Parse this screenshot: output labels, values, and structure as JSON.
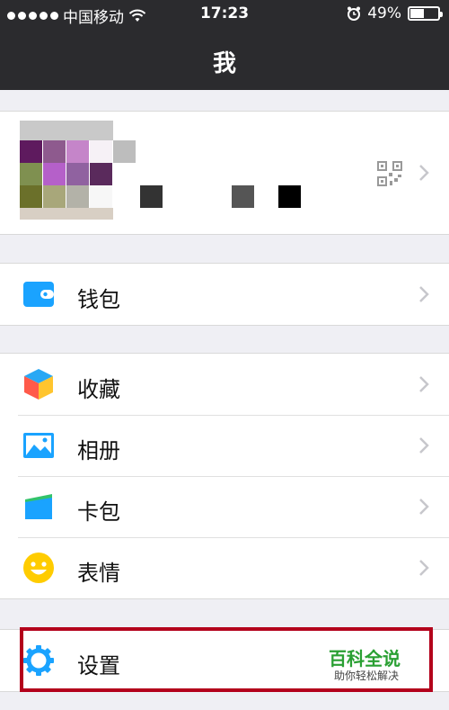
{
  "status_bar": {
    "carrier": "中国移动",
    "time": "17:23",
    "battery_percent": "49%",
    "battery_level": 0.49,
    "wifi_icon": "wifi-icon",
    "alarm_icon": "alarm-icon"
  },
  "navbar": {
    "title": "我"
  },
  "profile": {
    "avatar": "pixelated-avatar",
    "qr_icon": "qr-code-icon"
  },
  "menu": {
    "wallet": {
      "label": "钱包",
      "icon": "wallet-icon",
      "color": "#1aa3ff"
    },
    "favorites": {
      "label": "收藏",
      "icon": "cube-icon"
    },
    "album": {
      "label": "相册",
      "icon": "photo-icon",
      "color": "#1aa3ff"
    },
    "cards": {
      "label": "卡包",
      "icon": "card-icon"
    },
    "emoji": {
      "label": "表情",
      "icon": "smiley-icon",
      "color": "#ffcc00"
    },
    "settings": {
      "label": "设置",
      "icon": "gear-icon",
      "color": "#1aa3ff"
    }
  },
  "watermark": {
    "title": "百科全说",
    "subtitle": "助你轻松解决"
  },
  "colors": {
    "highlight_border": "#b3001b",
    "watermark_green": "#2aa033",
    "header_bg": "#2b2b2e"
  }
}
